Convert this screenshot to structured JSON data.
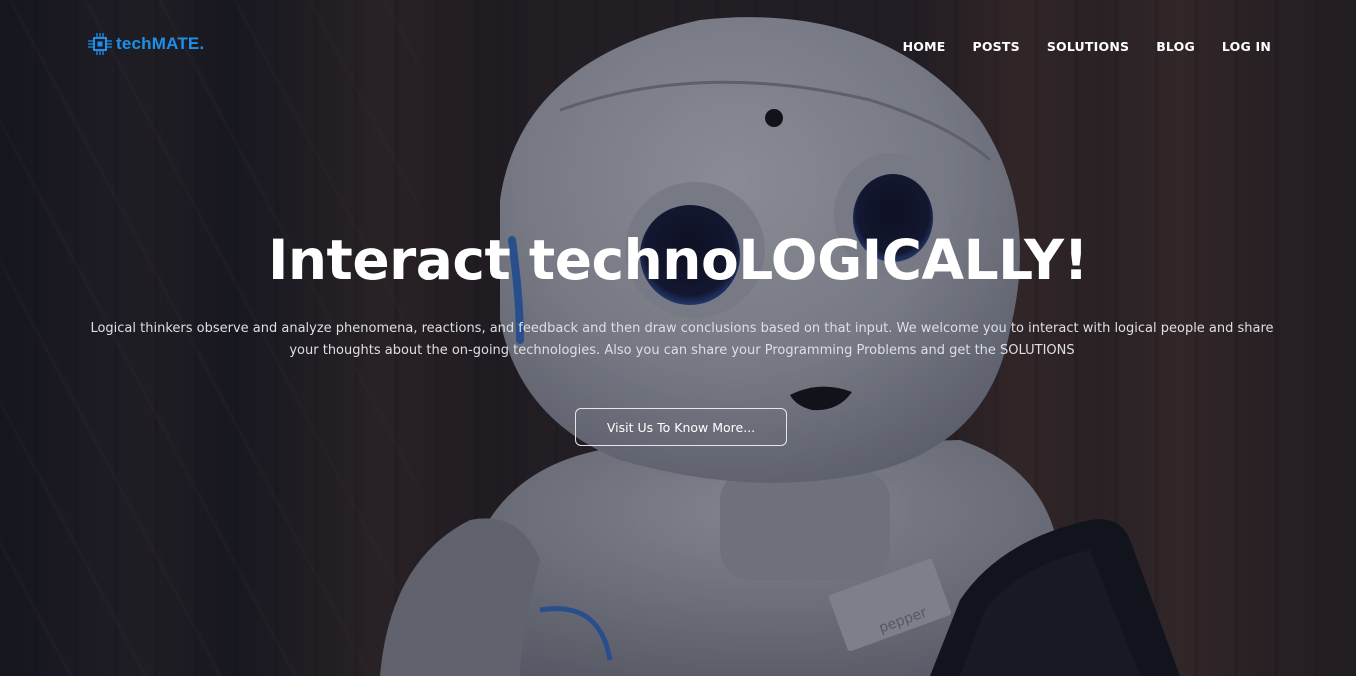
{
  "brand": {
    "name": "techMATE.",
    "icon": "circuit-chip-icon",
    "color": "#1e8fe8"
  },
  "nav": {
    "items": [
      {
        "label": "HOME"
      },
      {
        "label": "POSTS"
      },
      {
        "label": "SOLUTIONS"
      },
      {
        "label": "BLOG"
      },
      {
        "label": "LOG IN"
      }
    ]
  },
  "hero": {
    "headline": "Interact technoLOGICALLY!",
    "description": "Logical thinkers observe and analyze phenomena, reactions, and feedback and then draw conclusions based on that input. We welcome you to interact with logical people and share your thoughts about the on-going technologies. Also you can share your Programming Problems and get the SOLUTIONS",
    "cta_label": "Visit Us To Know More...",
    "robot_chest_label": "pepper",
    "background_image": "humanoid-robot-photo"
  }
}
